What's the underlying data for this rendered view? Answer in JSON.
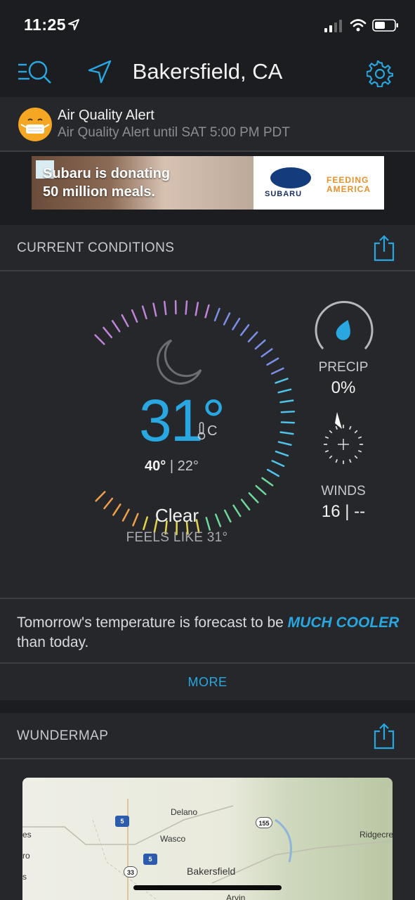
{
  "status": {
    "time": "11:25"
  },
  "header": {
    "city": "Bakersfield, CA"
  },
  "alert": {
    "title": "Air Quality Alert",
    "subtitle": "Air Quality Alert until SAT 5:00 PM PDT"
  },
  "ad": {
    "line1": "Subaru is donating",
    "line2": "50 million meals.",
    "brand": "SUBARU",
    "partner_line1": "FEEDING",
    "partner_line2": "AMERICA"
  },
  "conditions": {
    "section_title": "CURRENT CONDITIONS",
    "temperature": "31°",
    "unit": "C",
    "high": "40°",
    "low": "22°",
    "separator": "|",
    "condition": "Clear",
    "feels_like": "FEELS LIKE 31°",
    "precip_label": "PRECIP",
    "precip_value": "0%",
    "winds_label": "WINDS",
    "winds_value": "16 | --"
  },
  "forecast": {
    "prefix": "Tomorrow's temperature is forecast to be ",
    "highlight": "MUCH COOLER",
    "suffix": " than today."
  },
  "more": {
    "label": "MORE"
  },
  "map": {
    "section_title": "WUNDERMAP",
    "labels": [
      "Delano",
      "Wasco",
      "Bakersfield",
      "Ridgecre",
      "Arvin",
      "es",
      "ro",
      "s"
    ],
    "highways": [
      "5",
      "155",
      "5",
      "33"
    ]
  },
  "colors": {
    "accent": "#29a7e1",
    "background": "#1c1d20",
    "card": "#26272b"
  }
}
